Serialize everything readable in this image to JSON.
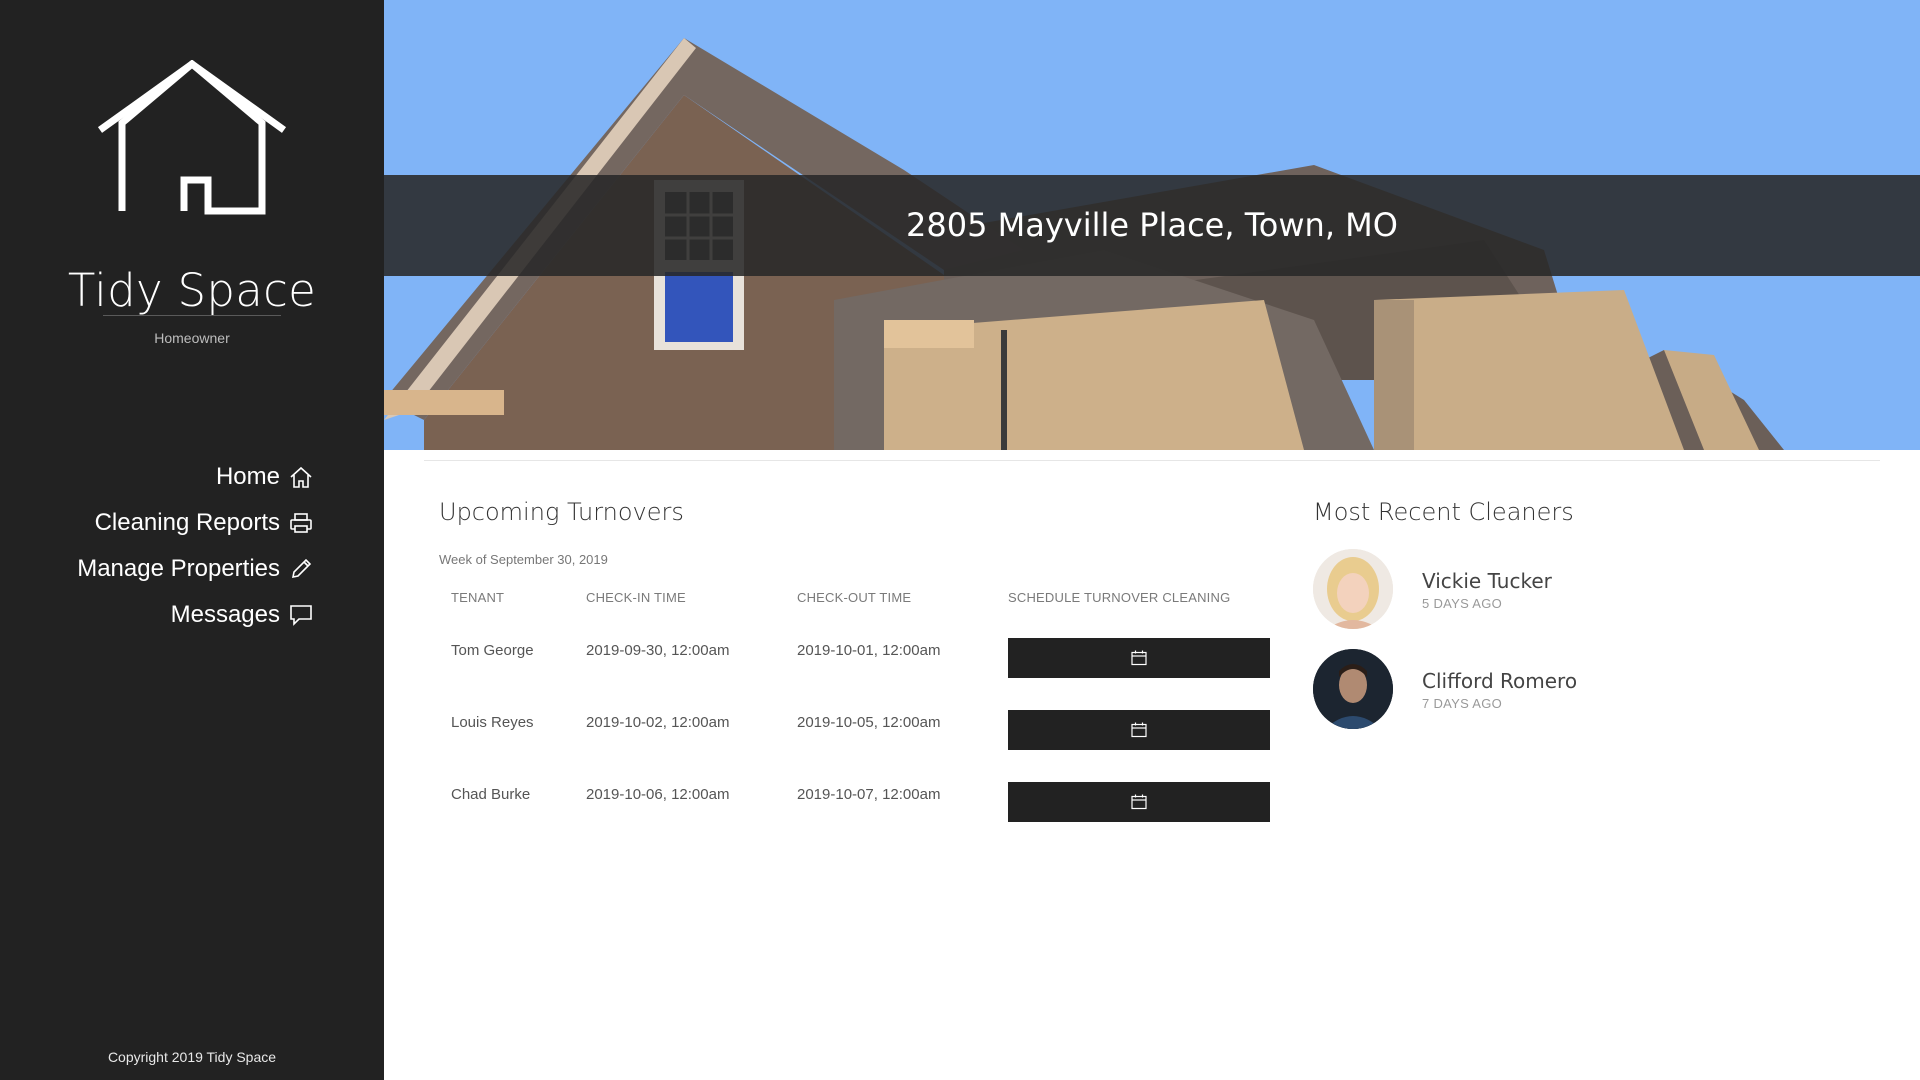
{
  "sidebar": {
    "brand": "Tidy Space",
    "role": "Homeowner",
    "nav": [
      {
        "label": "Home",
        "icon": "home-icon"
      },
      {
        "label": "Cleaning Reports",
        "icon": "printer-icon"
      },
      {
        "label": "Manage Properties",
        "icon": "pencil-icon"
      },
      {
        "label": "Messages",
        "icon": "chat-icon"
      }
    ],
    "copyright": "Copyright 2019 Tidy Space"
  },
  "hero": {
    "address": "2805 Mayville Place, Town, MO"
  },
  "turnovers": {
    "title": "Upcoming Turnovers",
    "week": "Week of September 30, 2019",
    "columns": [
      "TENANT",
      "CHECK-IN TIME",
      "CHECK-OUT TIME",
      "SCHEDULE TURNOVER CLEANING"
    ],
    "rows": [
      {
        "tenant": "Tom George",
        "check_in": "2019-09-30, 12:00am",
        "check_out": "2019-10-01, 12:00am"
      },
      {
        "tenant": "Louis Reyes",
        "check_in": "2019-10-02, 12:00am",
        "check_out": "2019-10-05, 12:00am"
      },
      {
        "tenant": "Chad Burke",
        "check_in": "2019-10-06, 12:00am",
        "check_out": "2019-10-07, 12:00am"
      }
    ],
    "button_icon": "calendar-icon"
  },
  "cleaners": {
    "title": "Most Recent Cleaners",
    "items": [
      {
        "name": "Vickie Tucker",
        "time": "5 DAYS AGO"
      },
      {
        "name": "Clifford Romero",
        "time": "7 DAYS AGO"
      }
    ]
  },
  "colors": {
    "sidebar_bg": "#222222",
    "sky": "#7fb3f5",
    "button_bg": "#222222"
  }
}
